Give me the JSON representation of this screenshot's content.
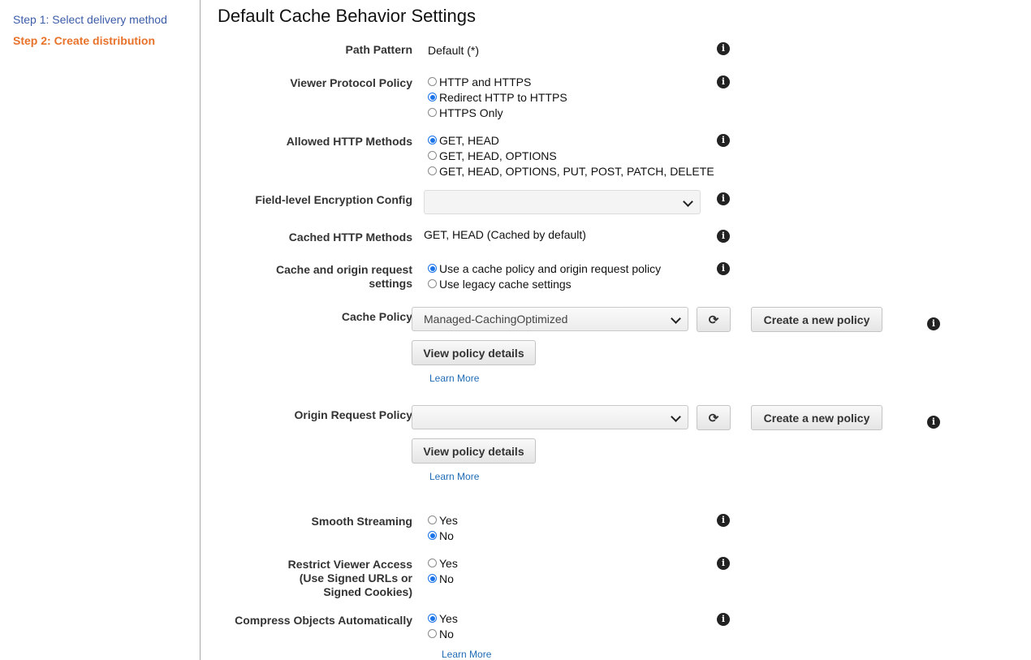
{
  "sidebar": {
    "steps": [
      {
        "label": "Step 1: Select delivery method",
        "state": "link"
      },
      {
        "label": "Step 2: Create distribution",
        "state": "current"
      }
    ]
  },
  "page": {
    "title": "Default Cache Behavior Settings"
  },
  "info_icon": "i",
  "refresh_icon": "⟳",
  "colors": {
    "step_link": "#3b5ca8",
    "step_current": "#e8722a",
    "radio_checked": "#1a73e8",
    "link": "#1f6bb5"
  },
  "fields": {
    "path_pattern": {
      "label": "Path Pattern",
      "value": "Default (*)"
    },
    "viewer_protocol_policy": {
      "label": "Viewer Protocol Policy",
      "options": [
        "HTTP and HTTPS",
        "Redirect HTTP to HTTPS",
        "HTTPS Only"
      ],
      "selected": "Redirect HTTP to HTTPS"
    },
    "allowed_http_methods": {
      "label": "Allowed HTTP Methods",
      "options": [
        "GET, HEAD",
        "GET, HEAD, OPTIONS",
        "GET, HEAD, OPTIONS, PUT, POST, PATCH, DELETE"
      ],
      "selected": "GET, HEAD"
    },
    "field_level_encryption": {
      "label": "Field-level Encryption Config",
      "value": ""
    },
    "cached_http_methods": {
      "label": "Cached HTTP Methods",
      "value": "GET, HEAD (Cached by default)"
    },
    "cache_origin_settings": {
      "label_line1": "Cache and origin request",
      "label_line2": "settings",
      "options": [
        "Use a cache policy and origin request policy",
        "Use legacy cache settings"
      ],
      "selected": "Use a cache policy and origin request policy"
    },
    "cache_policy": {
      "label": "Cache Policy",
      "value": "Managed-CachingOptimized",
      "create_label": "Create a new policy",
      "view_label": "View policy details",
      "learn_more": "Learn More"
    },
    "origin_request_policy": {
      "label": "Origin Request Policy",
      "value": "",
      "create_label": "Create a new policy",
      "view_label": "View policy details",
      "learn_more": "Learn More"
    },
    "smooth_streaming": {
      "label": "Smooth Streaming",
      "options": [
        "Yes",
        "No"
      ],
      "selected": "No"
    },
    "restrict_viewer_access": {
      "label_line1": "Restrict Viewer Access",
      "label_line2": "(Use Signed URLs or",
      "label_line3": "Signed Cookies)",
      "options": [
        "Yes",
        "No"
      ],
      "selected": "No"
    },
    "compress_objects": {
      "label": "Compress Objects Automatically",
      "options": [
        "Yes",
        "No"
      ],
      "selected": "Yes",
      "learn_more": "Learn More"
    }
  }
}
